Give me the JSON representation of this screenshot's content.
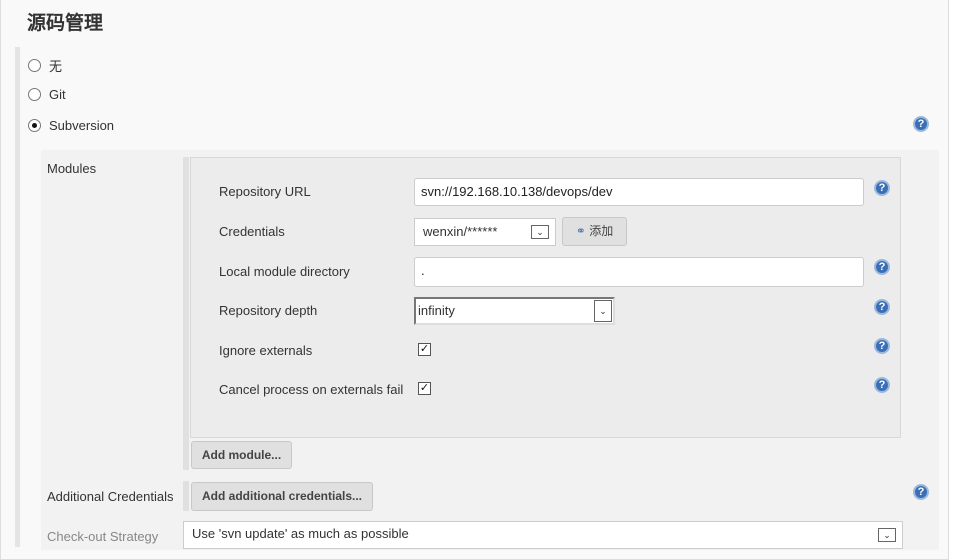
{
  "title": "源码管理",
  "scm_options": [
    {
      "label": "无",
      "selected": false
    },
    {
      "label": "Git",
      "selected": false
    },
    {
      "label": "Subversion",
      "selected": true
    }
  ],
  "modules": {
    "label": "Modules",
    "repo_url_label": "Repository URL",
    "repo_url": "svn://192.168.10.138/devops/dev",
    "credentials_label": "Credentials",
    "credentials_value": "wenxin/******",
    "add_label": "添加",
    "local_dir_label": "Local module directory",
    "local_dir": ".",
    "depth_label": "Repository depth",
    "depth_value": "infinity",
    "ignore_externals_label": "Ignore externals",
    "ignore_externals": true,
    "cancel_externals_label": "Cancel process on externals fail",
    "cancel_externals": true,
    "add_module": "Add module..."
  },
  "additional_credentials": {
    "label": "Additional Credentials",
    "button": "Add additional credentials..."
  },
  "checkout_strategy": {
    "label": "Check-out Strategy",
    "value": "Use 'svn update' as much as possible"
  },
  "help_symbol": "?"
}
